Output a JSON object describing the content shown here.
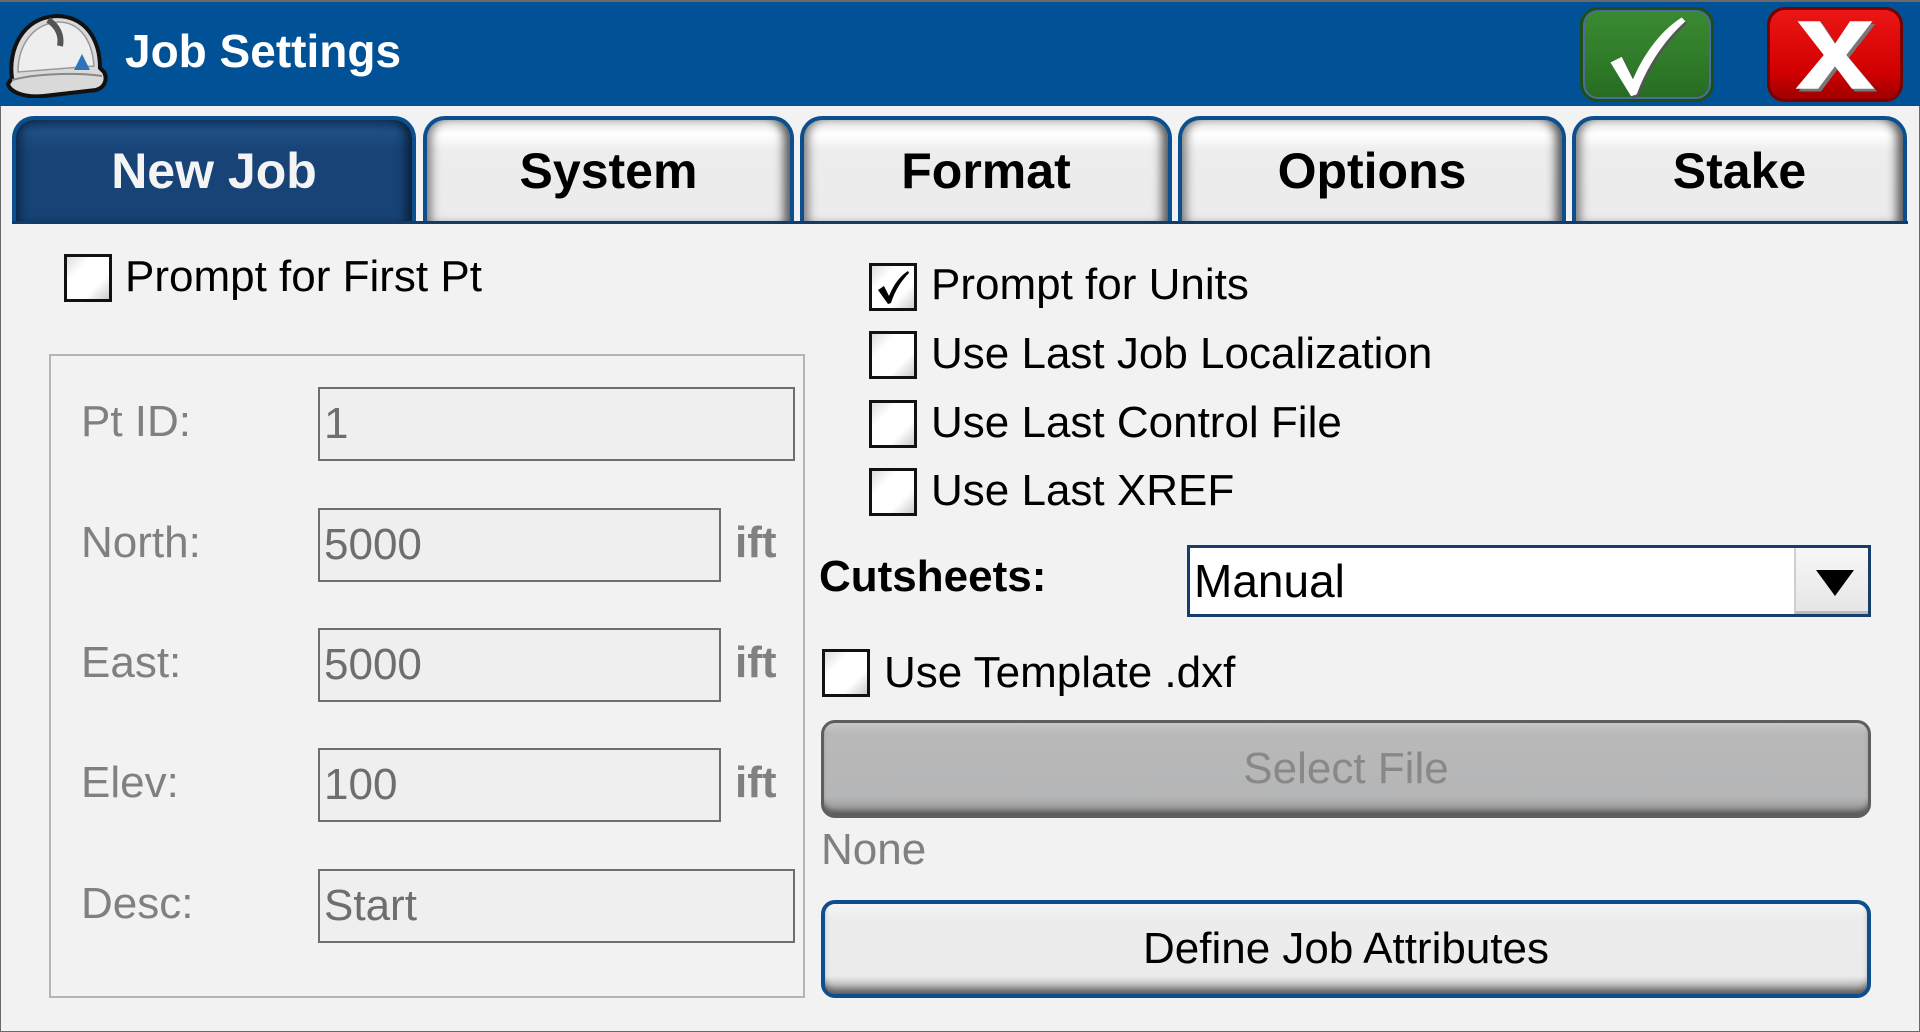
{
  "window": {
    "title": "Job Settings",
    "icon": "hard-hat-icon",
    "ok_icon": "checkmark-icon",
    "cancel_icon": "x-icon",
    "colors": {
      "titlebar": "#005195",
      "ok": "#2f7a29",
      "cancel": "#d10000",
      "active_tab": "#174377"
    }
  },
  "tabs": [
    {
      "label": "New Job",
      "active": true
    },
    {
      "label": "System",
      "active": false
    },
    {
      "label": "Format",
      "active": false
    },
    {
      "label": "Options",
      "active": false
    },
    {
      "label": "Stake",
      "active": false
    }
  ],
  "new_job": {
    "prompt_first_pt": {
      "label": "Prompt for First Pt",
      "checked": false
    },
    "fields": [
      {
        "label": "Pt ID:",
        "value": "1",
        "unit": ""
      },
      {
        "label": "North:",
        "value": "5000",
        "unit": "ift"
      },
      {
        "label": "East:",
        "value": "5000",
        "unit": "ift"
      },
      {
        "label": "Elev:",
        "value": "100",
        "unit": "ift"
      },
      {
        "label": "Desc:",
        "value": "Start",
        "unit": ""
      }
    ],
    "options": [
      {
        "label": "Prompt for Units",
        "checked": true
      },
      {
        "label": "Use Last Job Localization",
        "checked": false
      },
      {
        "label": "Use Last Control File",
        "checked": false
      },
      {
        "label": "Use Last XREF",
        "checked": false
      }
    ],
    "cutsheets": {
      "label": "Cutsheets:",
      "selected": "Manual"
    },
    "use_template": {
      "label": "Use Template .dxf",
      "checked": false
    },
    "select_file_label": "Select File",
    "selected_file": "None",
    "define_attributes_label": "Define Job Attributes"
  }
}
